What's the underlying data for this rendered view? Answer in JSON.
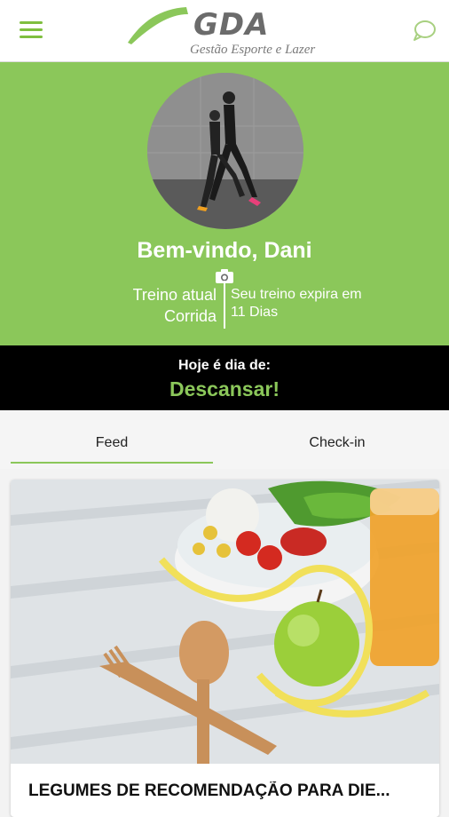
{
  "header": {
    "logo_title": "GDA",
    "logo_subtitle": "Gestão Esporte e Lazer",
    "menu_icon": "hamburger-menu-icon",
    "chat_icon": "chat-bubble-icon"
  },
  "profile": {
    "welcome": "Bem-vindo, Dani",
    "current_training_label": "Treino atual",
    "current_training_value": "Corrida",
    "expires_label": "Seu treino expira em",
    "expires_value": "11 Dias"
  },
  "today": {
    "label": "Hoje é dia de:",
    "value": "Descansar!"
  },
  "tabs": [
    {
      "label": "Feed",
      "active": true
    },
    {
      "label": "Check-in",
      "active": false
    }
  ],
  "feed": {
    "card_title": "LEGUMES DE RECOMENDAÇÃO PARA DIE..."
  },
  "colors": {
    "brand_green": "#8bc75a",
    "band_black": "#000000"
  }
}
